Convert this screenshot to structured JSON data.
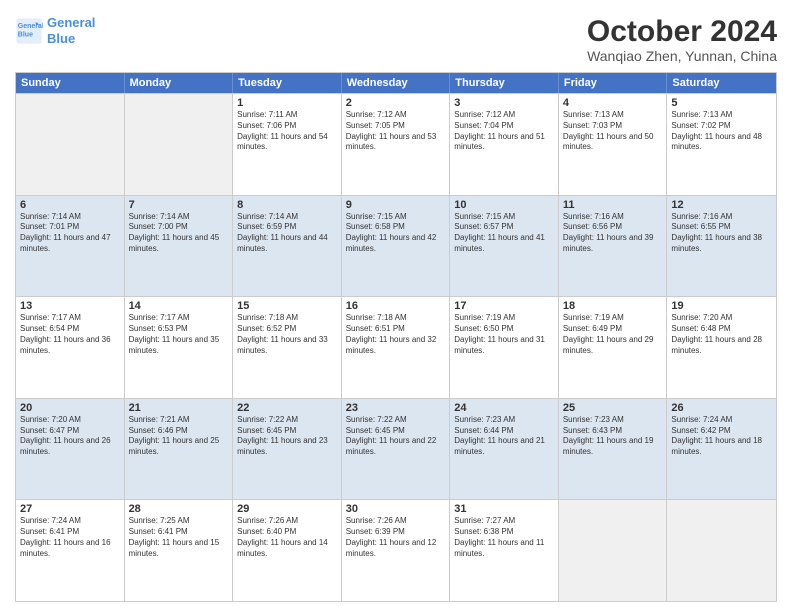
{
  "logo": {
    "line1": "General",
    "line2": "Blue"
  },
  "title": "October 2024",
  "subtitle": "Wanqiao Zhen, Yunnan, China",
  "days": [
    "Sunday",
    "Monday",
    "Tuesday",
    "Wednesday",
    "Thursday",
    "Friday",
    "Saturday"
  ],
  "rows": [
    [
      {
        "date": "",
        "sunrise": "",
        "sunset": "",
        "daylight": ""
      },
      {
        "date": "",
        "sunrise": "",
        "sunset": "",
        "daylight": ""
      },
      {
        "date": "1",
        "sunrise": "Sunrise: 7:11 AM",
        "sunset": "Sunset: 7:06 PM",
        "daylight": "Daylight: 11 hours and 54 minutes."
      },
      {
        "date": "2",
        "sunrise": "Sunrise: 7:12 AM",
        "sunset": "Sunset: 7:05 PM",
        "daylight": "Daylight: 11 hours and 53 minutes."
      },
      {
        "date": "3",
        "sunrise": "Sunrise: 7:12 AM",
        "sunset": "Sunset: 7:04 PM",
        "daylight": "Daylight: 11 hours and 51 minutes."
      },
      {
        "date": "4",
        "sunrise": "Sunrise: 7:13 AM",
        "sunset": "Sunset: 7:03 PM",
        "daylight": "Daylight: 11 hours and 50 minutes."
      },
      {
        "date": "5",
        "sunrise": "Sunrise: 7:13 AM",
        "sunset": "Sunset: 7:02 PM",
        "daylight": "Daylight: 11 hours and 48 minutes."
      }
    ],
    [
      {
        "date": "6",
        "sunrise": "Sunrise: 7:14 AM",
        "sunset": "Sunset: 7:01 PM",
        "daylight": "Daylight: 11 hours and 47 minutes."
      },
      {
        "date": "7",
        "sunrise": "Sunrise: 7:14 AM",
        "sunset": "Sunset: 7:00 PM",
        "daylight": "Daylight: 11 hours and 45 minutes."
      },
      {
        "date": "8",
        "sunrise": "Sunrise: 7:14 AM",
        "sunset": "Sunset: 6:59 PM",
        "daylight": "Daylight: 11 hours and 44 minutes."
      },
      {
        "date": "9",
        "sunrise": "Sunrise: 7:15 AM",
        "sunset": "Sunset: 6:58 PM",
        "daylight": "Daylight: 11 hours and 42 minutes."
      },
      {
        "date": "10",
        "sunrise": "Sunrise: 7:15 AM",
        "sunset": "Sunset: 6:57 PM",
        "daylight": "Daylight: 11 hours and 41 minutes."
      },
      {
        "date": "11",
        "sunrise": "Sunrise: 7:16 AM",
        "sunset": "Sunset: 6:56 PM",
        "daylight": "Daylight: 11 hours and 39 minutes."
      },
      {
        "date": "12",
        "sunrise": "Sunrise: 7:16 AM",
        "sunset": "Sunset: 6:55 PM",
        "daylight": "Daylight: 11 hours and 38 minutes."
      }
    ],
    [
      {
        "date": "13",
        "sunrise": "Sunrise: 7:17 AM",
        "sunset": "Sunset: 6:54 PM",
        "daylight": "Daylight: 11 hours and 36 minutes."
      },
      {
        "date": "14",
        "sunrise": "Sunrise: 7:17 AM",
        "sunset": "Sunset: 6:53 PM",
        "daylight": "Daylight: 11 hours and 35 minutes."
      },
      {
        "date": "15",
        "sunrise": "Sunrise: 7:18 AM",
        "sunset": "Sunset: 6:52 PM",
        "daylight": "Daylight: 11 hours and 33 minutes."
      },
      {
        "date": "16",
        "sunrise": "Sunrise: 7:18 AM",
        "sunset": "Sunset: 6:51 PM",
        "daylight": "Daylight: 11 hours and 32 minutes."
      },
      {
        "date": "17",
        "sunrise": "Sunrise: 7:19 AM",
        "sunset": "Sunset: 6:50 PM",
        "daylight": "Daylight: 11 hours and 31 minutes."
      },
      {
        "date": "18",
        "sunrise": "Sunrise: 7:19 AM",
        "sunset": "Sunset: 6:49 PM",
        "daylight": "Daylight: 11 hours and 29 minutes."
      },
      {
        "date": "19",
        "sunrise": "Sunrise: 7:20 AM",
        "sunset": "Sunset: 6:48 PM",
        "daylight": "Daylight: 11 hours and 28 minutes."
      }
    ],
    [
      {
        "date": "20",
        "sunrise": "Sunrise: 7:20 AM",
        "sunset": "Sunset: 6:47 PM",
        "daylight": "Daylight: 11 hours and 26 minutes."
      },
      {
        "date": "21",
        "sunrise": "Sunrise: 7:21 AM",
        "sunset": "Sunset: 6:46 PM",
        "daylight": "Daylight: 11 hours and 25 minutes."
      },
      {
        "date": "22",
        "sunrise": "Sunrise: 7:22 AM",
        "sunset": "Sunset: 6:45 PM",
        "daylight": "Daylight: 11 hours and 23 minutes."
      },
      {
        "date": "23",
        "sunrise": "Sunrise: 7:22 AM",
        "sunset": "Sunset: 6:45 PM",
        "daylight": "Daylight: 11 hours and 22 minutes."
      },
      {
        "date": "24",
        "sunrise": "Sunrise: 7:23 AM",
        "sunset": "Sunset: 6:44 PM",
        "daylight": "Daylight: 11 hours and 21 minutes."
      },
      {
        "date": "25",
        "sunrise": "Sunrise: 7:23 AM",
        "sunset": "Sunset: 6:43 PM",
        "daylight": "Daylight: 11 hours and 19 minutes."
      },
      {
        "date": "26",
        "sunrise": "Sunrise: 7:24 AM",
        "sunset": "Sunset: 6:42 PM",
        "daylight": "Daylight: 11 hours and 18 minutes."
      }
    ],
    [
      {
        "date": "27",
        "sunrise": "Sunrise: 7:24 AM",
        "sunset": "Sunset: 6:41 PM",
        "daylight": "Daylight: 11 hours and 16 minutes."
      },
      {
        "date": "28",
        "sunrise": "Sunrise: 7:25 AM",
        "sunset": "Sunset: 6:41 PM",
        "daylight": "Daylight: 11 hours and 15 minutes."
      },
      {
        "date": "29",
        "sunrise": "Sunrise: 7:26 AM",
        "sunset": "Sunset: 6:40 PM",
        "daylight": "Daylight: 11 hours and 14 minutes."
      },
      {
        "date": "30",
        "sunrise": "Sunrise: 7:26 AM",
        "sunset": "Sunset: 6:39 PM",
        "daylight": "Daylight: 11 hours and 12 minutes."
      },
      {
        "date": "31",
        "sunrise": "Sunrise: 7:27 AM",
        "sunset": "Sunset: 6:38 PM",
        "daylight": "Daylight: 11 hours and 11 minutes."
      },
      {
        "date": "",
        "sunrise": "",
        "sunset": "",
        "daylight": ""
      },
      {
        "date": "",
        "sunrise": "",
        "sunset": "",
        "daylight": ""
      }
    ]
  ],
  "colors": {
    "header_bg": "#4472C4",
    "row_alt": "#dce6f1",
    "row_normal": "#ffffff",
    "empty": "#f0f0f0"
  }
}
